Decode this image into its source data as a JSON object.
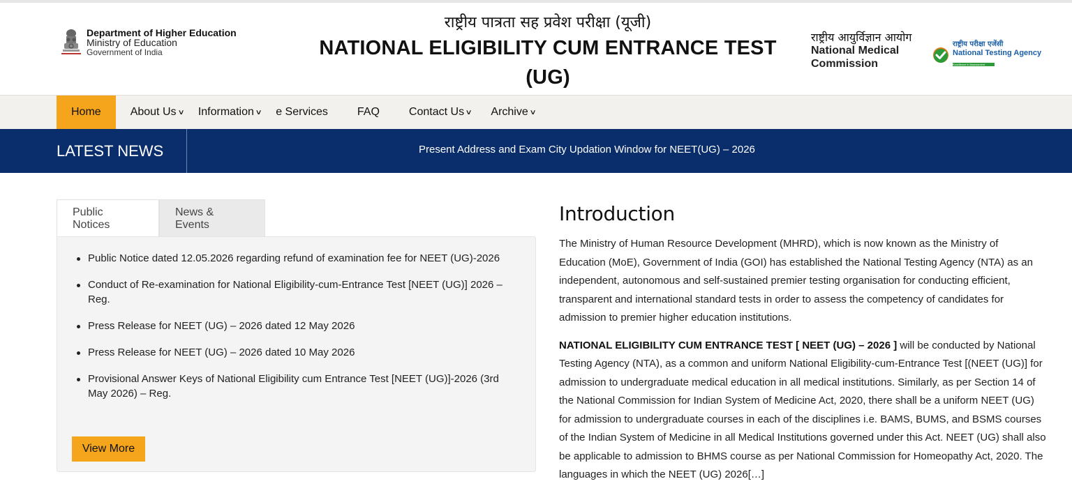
{
  "header": {
    "dept_name": "Department of Higher Education",
    "ministry": "Ministry of Education",
    "government": "Government of India",
    "title_hindi": "राष्ट्रीय पात्रता सह प्रवेश परीक्षा (यूजी)",
    "title_line1": "NATIONAL ELIGIBILITY CUM ENTRANCE TEST",
    "title_line2": "(UG)",
    "nmc_hindi": "राष्ट्रीय आयुर्विज्ञान आयोग",
    "nmc_line1": "National Medical",
    "nmc_line2": "Commission",
    "nta_hindi": "राष्ट्रीय परीक्षा एजेंसी",
    "nta_english": "National Testing Agency",
    "nta_tagline": "Excellence in Assessment"
  },
  "nav": {
    "home": "Home",
    "about": "About Us",
    "information": "Information",
    "eservices": "e Services",
    "faq": "FAQ",
    "contact": "Contact Us",
    "archive": "Archive"
  },
  "news": {
    "label": "LATEST NEWS",
    "ticker": "Present Address and Exam City Updation Window for NEET(UG) – 2026"
  },
  "tabs": {
    "public_notices": "Public Notices",
    "news_events": "News & Events"
  },
  "notices": [
    "Public Notice dated 12.05.2026 regarding refund of examination fee for NEET (UG)-2026",
    "Conduct of Re-examination for National Eligibility-cum-Entrance Test [NEET (UG)] 2026 – Reg.",
    "Press Release for NEET (UG) – 2026 dated 12 May 2026",
    "Press Release for NEET (UG) – 2026 dated 10 May 2026",
    "Provisional Answer Keys of National Eligibility cum Entrance Test [NEET (UG)]-2026 (3rd May 2026) – Reg."
  ],
  "view_more": "View More",
  "intro": {
    "heading": "Introduction",
    "para1": "The Ministry of Human Resource Development (MHRD), which is now known as the Ministry of Education (MoE), Government of India (GOI) has established the National Testing Agency (NTA) as an independent, autonomous and self-sustained premier testing organisation for conducting efficient, transparent and international standard tests in order to assess the competency of candidates for admission to premier higher education institutions.",
    "para2_bold": "NATIONAL ELIGIBILITY CUM ENTRANCE TEST [ NEET (UG) – 2026 ]",
    "para2_rest": " will be conducted by National Testing Agency (NTA), as a common and uniform National Eligibility-cum-Entrance Test [(NEET (UG)] for admission to undergraduate medical education in all medical institutions. Similarly, as per Section 14 of the National Commission for Indian System of Medicine Act, 2020, there shall be a uniform NEET (UG) for admission to undergraduate courses in each of the disciplines i.e. BAMS, BUMS, and BSMS courses of the Indian System of Medicine in all Medical Institutions governed under this Act. NEET (UG) shall also be applicable to admission to BHMS course as per National Commission for Homeopathy Act, 2020. The languages in which the NEET (UG) 2026[…]"
  },
  "colors": {
    "accent": "#f5a51c",
    "navy": "#0a2d6b",
    "nav_bg": "#f3f1ee"
  }
}
